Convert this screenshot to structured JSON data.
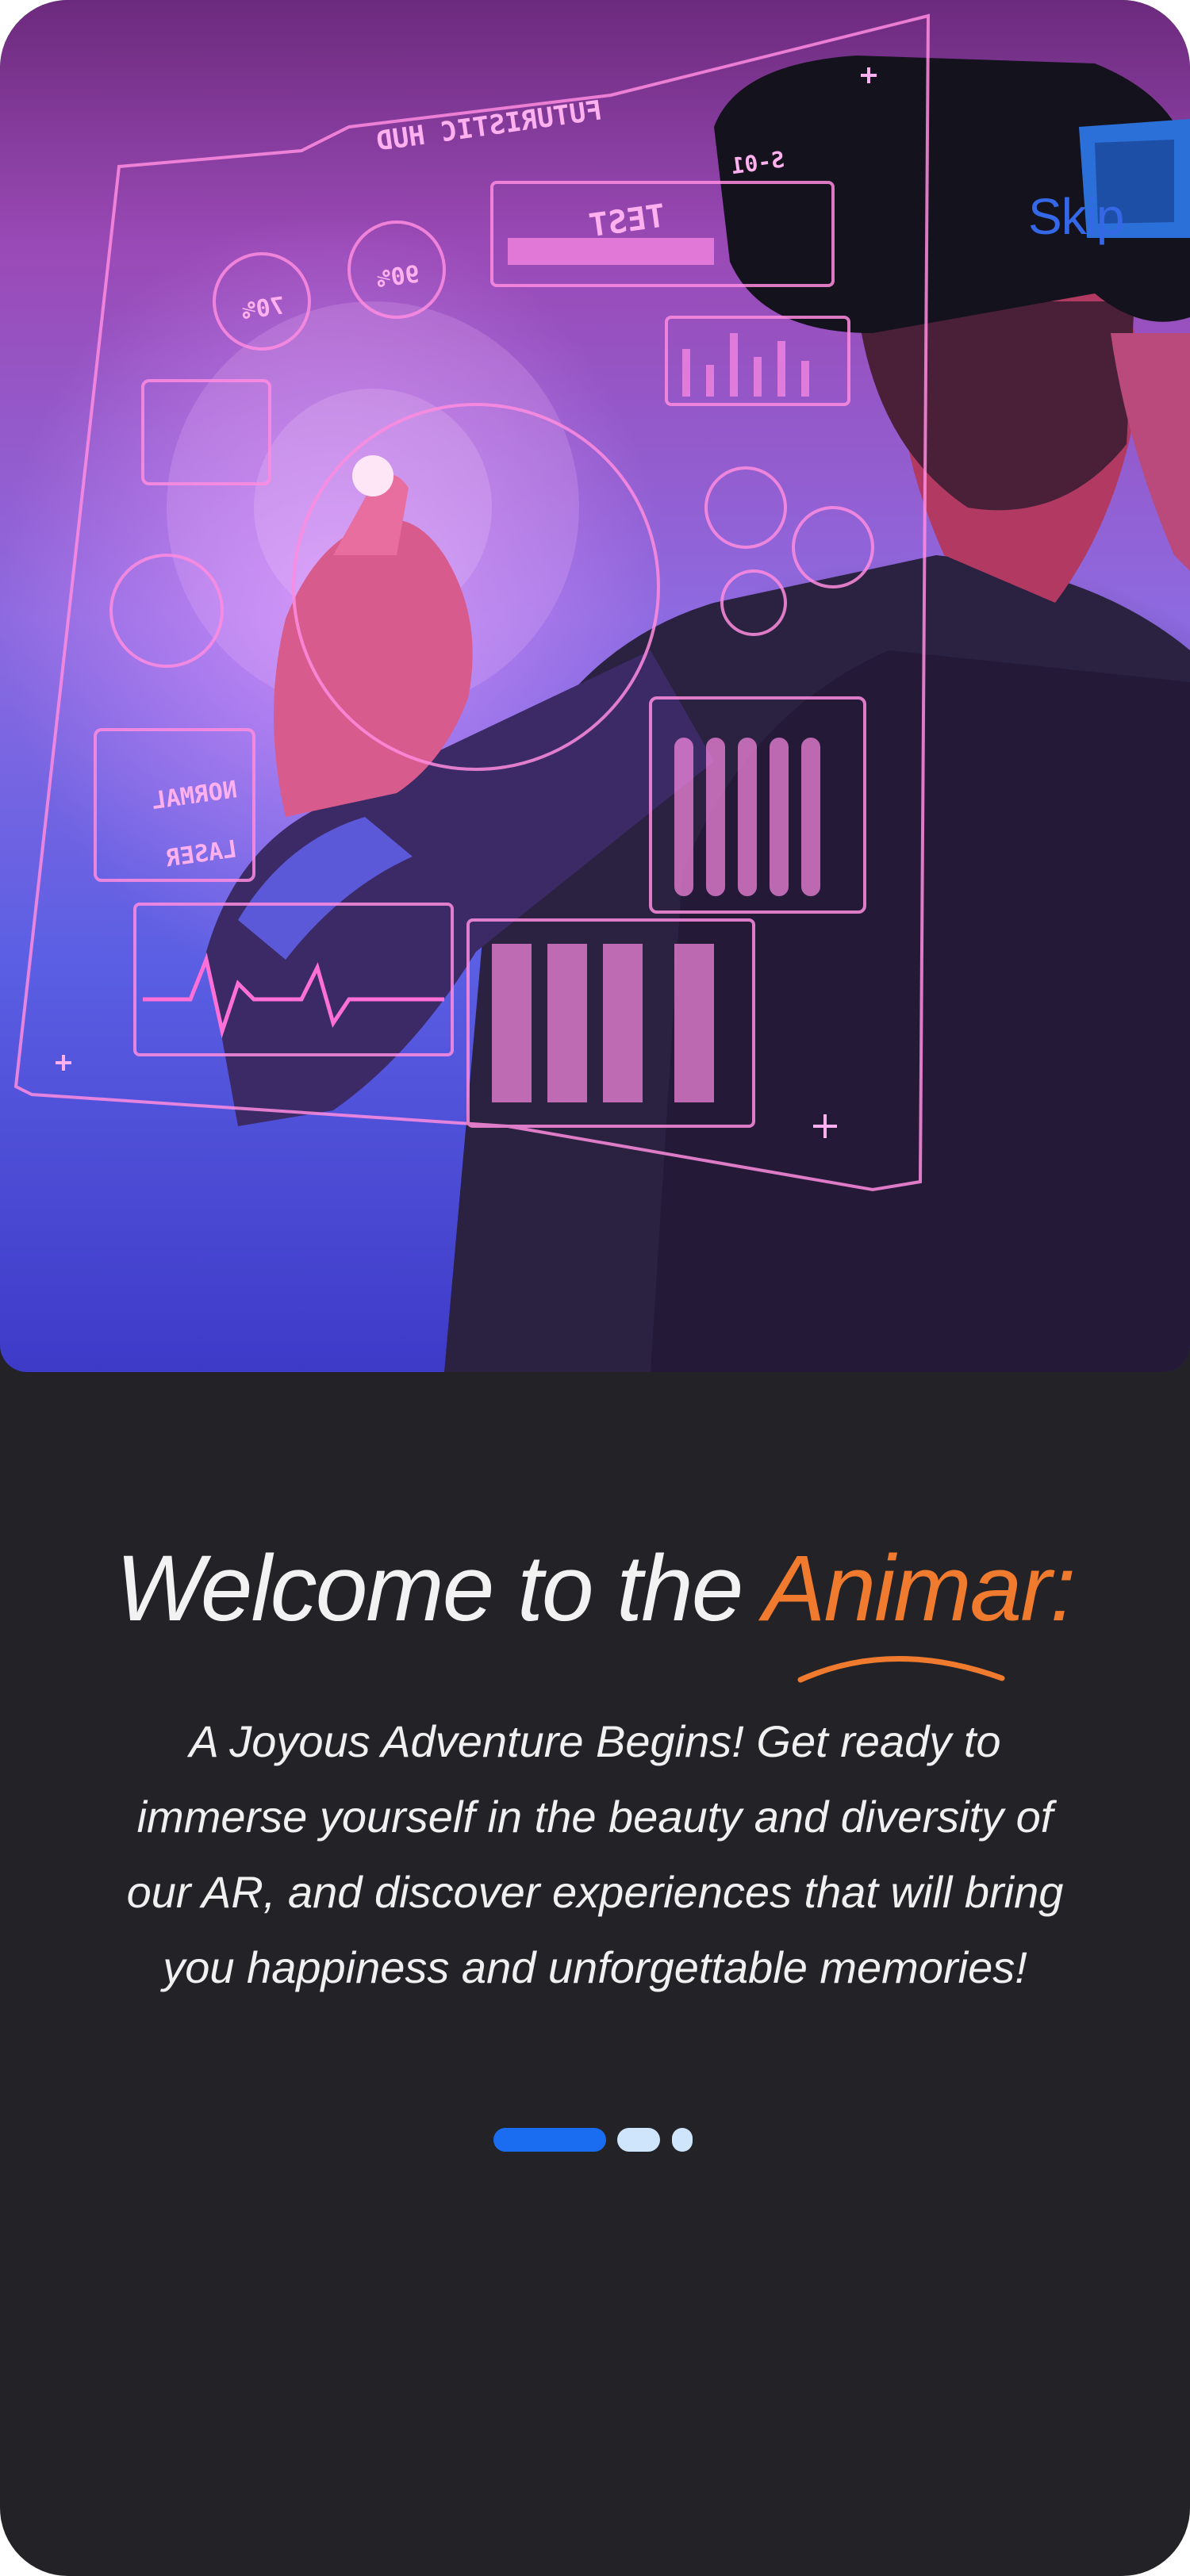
{
  "onboarding": {
    "skip_label": "Skip",
    "title_prefix": "Welcome to the ",
    "title_accent": "Animar:",
    "description": "A Joyous Adventure Begins! Get ready to immerse yourself in the beauty and diversity of our AR, and discover experiences that will bring you happiness and unforgettable memories!",
    "pagination": {
      "current": 1,
      "total": 3
    }
  },
  "hero": {
    "hud_title": "FUTURISTIC HUD",
    "hud_test_label": "TEST",
    "hud_small_label": "S-01",
    "gauge_left": "70%",
    "gauge_right": "90%",
    "hud_mode_a": "NORMAL",
    "hud_mode_b": "LASER"
  },
  "colors": {
    "background": "#232327",
    "accent_orange": "#f07a2e",
    "skip_blue": "#3568e6",
    "dot_active": "#1a6cf0",
    "dot_inactive": "#cfe5fb"
  }
}
